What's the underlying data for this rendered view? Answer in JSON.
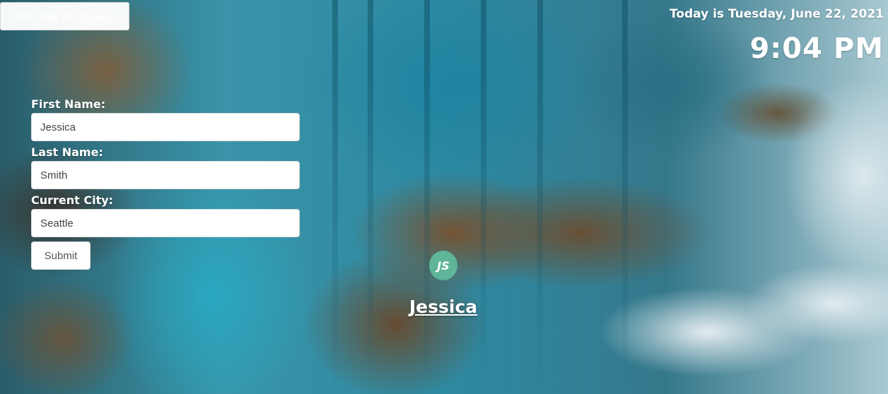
{
  "header": {
    "edit_button_label": "Edit User Information",
    "date_text": "Today is Tuesday, June 22, 2021",
    "time_text": "9:04 PM"
  },
  "form": {
    "first_name_label": "First Name:",
    "first_name_value": "Jessica",
    "last_name_label": "Last Name:",
    "last_name_value": "Smith",
    "city_label": "Current City:",
    "city_value": "Seattle",
    "submit_label": "Submit"
  },
  "profile": {
    "initials": "JS",
    "display_name": "Jessica",
    "avatar_color": "#5fb59a"
  }
}
